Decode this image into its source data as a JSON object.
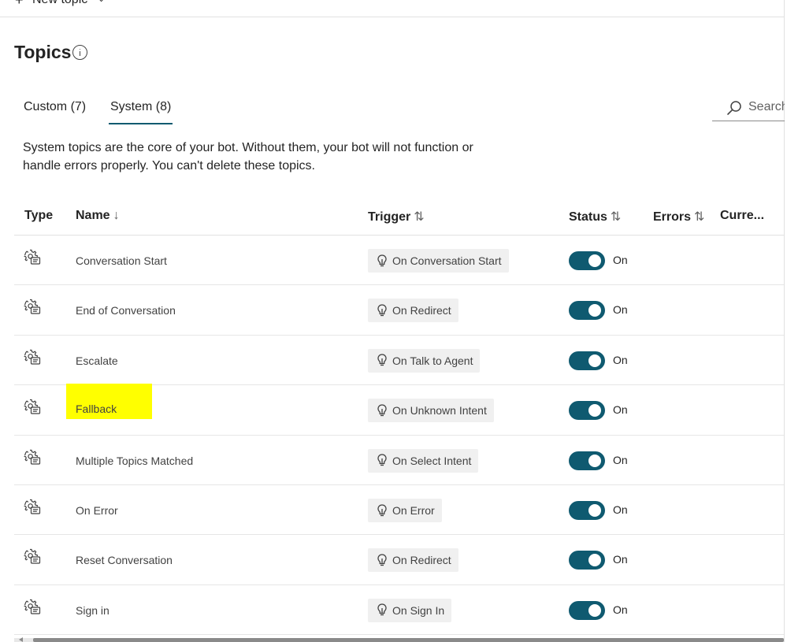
{
  "toolbar": {
    "new_topic_label": "New topic"
  },
  "page": {
    "title": "Topics"
  },
  "tabs": [
    {
      "label": "Custom (7)"
    },
    {
      "label": "System (8)"
    }
  ],
  "search": {
    "label": "Search"
  },
  "description": "System topics are the core of your bot. Without them, your bot will not function or handle errors properly. You can't delete these topics.",
  "columns": {
    "type": "Type",
    "name": "Name",
    "trigger": "Trigger",
    "status": "Status",
    "errors": "Errors",
    "current": "Curre..."
  },
  "rows": [
    {
      "name": "Conversation Start",
      "trigger": "On Conversation Start",
      "status": "On",
      "highlighted": false
    },
    {
      "name": "End of Conversation",
      "trigger": "On Redirect",
      "status": "On",
      "highlighted": false
    },
    {
      "name": "Escalate",
      "trigger": "On Talk to Agent",
      "status": "On",
      "highlighted": false
    },
    {
      "name": "Fallback",
      "trigger": "On Unknown Intent",
      "status": "On",
      "highlighted": true
    },
    {
      "name": "Multiple Topics Matched",
      "trigger": "On Select Intent",
      "status": "On",
      "highlighted": false
    },
    {
      "name": "On Error",
      "trigger": "On Error",
      "status": "On",
      "highlighted": false
    },
    {
      "name": "Reset Conversation",
      "trigger": "On Redirect",
      "status": "On",
      "highlighted": false
    },
    {
      "name": "Sign in",
      "trigger": "On Sign In",
      "status": "On",
      "highlighted": false
    }
  ],
  "colors": {
    "accent": "#0f5a70",
    "highlight": "#ffff00",
    "chip_bg": "#f0f0f0"
  },
  "icons": {
    "type": "system-topic-gear-icon",
    "trigger": "lightbulb-icon",
    "search": "search-icon",
    "info": "info-icon"
  }
}
